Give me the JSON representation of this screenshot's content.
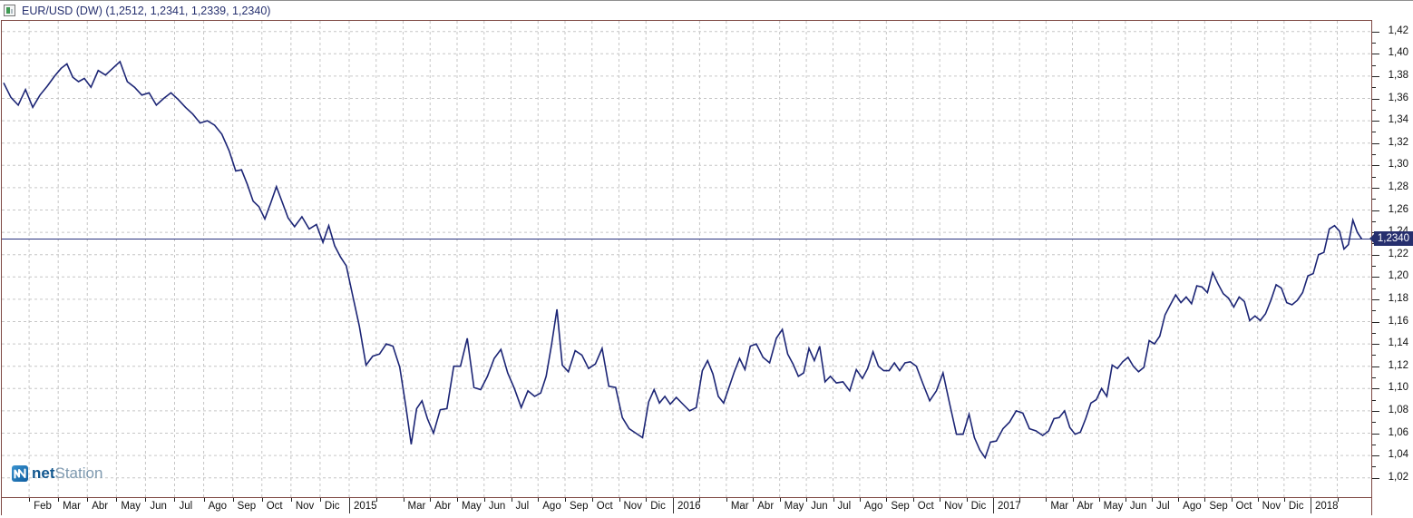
{
  "title_bar": {
    "title": "EUR/USD (DW) (1,2512, 1,2341, 1,2339, 1,2340)"
  },
  "logo": {
    "bold": "net",
    "light": "Station"
  },
  "colors": {
    "frame": "#7d4742",
    "series_line": "#1c2575",
    "grid": "#c6c6c6",
    "last_price_line": "#2a3480",
    "tag_bg": "#262f6e",
    "tag_text": "#ffffff",
    "title_text": "#252f6e",
    "axis_text": "#111111"
  },
  "chart_data": {
    "type": "line",
    "symbol": "EUR/USD",
    "timeframe_label": "(DW)",
    "ohlc_readout": [
      "1,2512",
      "1,2341",
      "1,2339",
      "1,2340"
    ],
    "last_price": 1.234,
    "last_price_label": "1,2340",
    "ylim": [
      1.005,
      1.435
    ],
    "grid": {
      "vertical": "monthly-dashed",
      "horizontal": "0.02-dashed"
    },
    "legend": "none",
    "y_ticks": [
      {
        "v": 1.42,
        "label": "1,42"
      },
      {
        "v": 1.4,
        "label": "1,40"
      },
      {
        "v": 1.38,
        "label": "1,38"
      },
      {
        "v": 1.36,
        "label": "1,36"
      },
      {
        "v": 1.34,
        "label": "1,34"
      },
      {
        "v": 1.32,
        "label": "1,32"
      },
      {
        "v": 1.3,
        "label": "1,30"
      },
      {
        "v": 1.28,
        "label": "1,28"
      },
      {
        "v": 1.26,
        "label": "1,26"
      },
      {
        "v": 1.24,
        "label": "1,24"
      },
      {
        "v": 1.22,
        "label": "1,22"
      },
      {
        "v": 1.2,
        "label": "1,20"
      },
      {
        "v": 1.18,
        "label": "1,18"
      },
      {
        "v": 1.16,
        "label": "1,16"
      },
      {
        "v": 1.14,
        "label": "1,14"
      },
      {
        "v": 1.12,
        "label": "1,12"
      },
      {
        "v": 1.1,
        "label": "1,10"
      },
      {
        "v": 1.08,
        "label": "1,08"
      },
      {
        "v": 1.06,
        "label": "1,06"
      },
      {
        "v": 1.04,
        "label": "1,04"
      },
      {
        "v": 1.02,
        "label": "1,02"
      }
    ],
    "x_labels": [
      {
        "text": "Feb",
        "m": 1
      },
      {
        "text": "Mar",
        "m": 2
      },
      {
        "text": "Abr",
        "m": 3
      },
      {
        "text": "May",
        "m": 4
      },
      {
        "text": "Jun",
        "m": 5
      },
      {
        "text": "Jul",
        "m": 6
      },
      {
        "text": "Ago",
        "m": 7
      },
      {
        "text": "Sep",
        "m": 8
      },
      {
        "text": "Oct",
        "m": 9
      },
      {
        "text": "Nov",
        "m": 10
      },
      {
        "text": "Dic",
        "m": 11
      },
      {
        "text": "2015",
        "m": 12,
        "year": true
      },
      {
        "text": "Mar",
        "m": 14
      },
      {
        "text": "Abr",
        "m": 15
      },
      {
        "text": "May",
        "m": 16
      },
      {
        "text": "Jun",
        "m": 17
      },
      {
        "text": "Jul",
        "m": 18
      },
      {
        "text": "Ago",
        "m": 19
      },
      {
        "text": "Sep",
        "m": 20
      },
      {
        "text": "Oct",
        "m": 21
      },
      {
        "text": "Nov",
        "m": 22
      },
      {
        "text": "Dic",
        "m": 23
      },
      {
        "text": "2016",
        "m": 24,
        "year": true
      },
      {
        "text": "Mar",
        "m": 26
      },
      {
        "text": "Abr",
        "m": 27
      },
      {
        "text": "May",
        "m": 28
      },
      {
        "text": "Jun",
        "m": 29
      },
      {
        "text": "Jul",
        "m": 30
      },
      {
        "text": "Ago",
        "m": 31
      },
      {
        "text": "Sep",
        "m": 32
      },
      {
        "text": "Oct",
        "m": 33
      },
      {
        "text": "Nov",
        "m": 34
      },
      {
        "text": "Dic",
        "m": 35
      },
      {
        "text": "2017",
        "m": 36,
        "year": true
      },
      {
        "text": "Mar",
        "m": 38
      },
      {
        "text": "Abr",
        "m": 39
      },
      {
        "text": "May",
        "m": 40
      },
      {
        "text": "Jun",
        "m": 41
      },
      {
        "text": "Jul",
        "m": 42
      },
      {
        "text": "Ago",
        "m": 43
      },
      {
        "text": "Sep",
        "m": 44
      },
      {
        "text": "Oct",
        "m": 45
      },
      {
        "text": "Nov",
        "m": 46
      },
      {
        "text": "Dic",
        "m": 47
      },
      {
        "text": "2018",
        "m": 48,
        "year": true
      }
    ],
    "series": [
      {
        "month": "2014-01",
        "values": [
          1.374,
          1.361,
          1.354,
          1.368
        ]
      },
      {
        "month": "2014-02",
        "values": [
          1.352,
          1.363,
          1.371,
          1.38
        ]
      },
      {
        "month": "2014-03",
        "values": [
          1.387,
          1.391,
          1.379,
          1.375,
          1.378
        ]
      },
      {
        "month": "2014-04",
        "values": [
          1.37,
          1.385,
          1.381,
          1.387
        ]
      },
      {
        "month": "2014-05",
        "values": [
          1.393,
          1.375,
          1.37,
          1.363
        ]
      },
      {
        "month": "2014-06",
        "values": [
          1.365,
          1.354,
          1.36,
          1.365
        ]
      },
      {
        "month": "2014-07",
        "values": [
          1.359,
          1.352,
          1.346,
          1.338
        ]
      },
      {
        "month": "2014-08",
        "values": [
          1.34,
          1.336,
          1.328,
          1.313
        ]
      },
      {
        "month": "2014-09",
        "values": [
          1.295,
          1.296,
          1.283,
          1.268,
          1.263
        ]
      },
      {
        "month": "2014-10",
        "values": [
          1.252,
          1.266,
          1.281,
          1.267,
          1.253
        ]
      },
      {
        "month": "2014-11",
        "values": [
          1.245,
          1.254,
          1.243,
          1.247
        ]
      },
      {
        "month": "2014-12",
        "values": [
          1.231,
          1.246,
          1.228,
          1.218,
          1.21
        ]
      },
      {
        "month": "2015-01",
        "values": [
          1.184,
          1.156,
          1.121,
          1.129
        ]
      },
      {
        "month": "2015-02",
        "values": [
          1.131,
          1.14,
          1.138,
          1.119
        ]
      },
      {
        "month": "2015-03",
        "values": [
          1.084,
          1.05,
          1.082,
          1.089,
          1.073
        ]
      },
      {
        "month": "2015-04",
        "values": [
          1.06,
          1.081,
          1.082,
          1.12
        ]
      },
      {
        "month": "2015-05",
        "values": [
          1.12,
          1.145,
          1.101,
          1.099
        ]
      },
      {
        "month": "2015-06",
        "values": [
          1.111,
          1.127,
          1.135,
          1.114
        ]
      },
      {
        "month": "2015-07",
        "values": [
          1.1,
          1.083,
          1.098,
          1.093
        ]
      },
      {
        "month": "2015-08",
        "values": [
          1.096,
          1.111,
          1.139,
          1.171,
          1.121
        ]
      },
      {
        "month": "2015-09",
        "values": [
          1.115,
          1.134,
          1.13,
          1.118
        ]
      },
      {
        "month": "2015-10",
        "values": [
          1.122,
          1.136,
          1.102,
          1.101
        ]
      },
      {
        "month": "2015-11",
        "values": [
          1.074,
          1.064,
          1.06,
          1.056
        ]
      },
      {
        "month": "2015-12",
        "values": [
          1.088,
          1.099,
          1.087,
          1.093,
          1.086
        ]
      },
      {
        "month": "2016-01",
        "values": [
          1.092,
          1.086,
          1.08,
          1.083
        ]
      },
      {
        "month": "2016-02",
        "values": [
          1.116,
          1.125,
          1.113,
          1.093,
          1.087
        ]
      },
      {
        "month": "2016-03",
        "values": [
          1.101,
          1.115,
          1.127,
          1.117,
          1.138
        ]
      },
      {
        "month": "2016-04",
        "values": [
          1.14,
          1.128,
          1.123,
          1.145
        ]
      },
      {
        "month": "2016-05",
        "values": [
          1.153,
          1.131,
          1.122,
          1.111,
          1.114
        ]
      },
      {
        "month": "2016-06",
        "values": [
          1.136,
          1.125,
          1.138,
          1.106,
          1.111
        ]
      },
      {
        "month": "2016-07",
        "values": [
          1.105,
          1.106,
          1.098,
          1.117
        ]
      },
      {
        "month": "2016-08",
        "values": [
          1.109,
          1.118,
          1.133,
          1.12,
          1.116
        ]
      },
      {
        "month": "2016-09",
        "values": [
          1.116,
          1.123,
          1.116,
          1.123,
          1.124
        ]
      },
      {
        "month": "2016-10",
        "values": [
          1.12,
          1.104,
          1.089,
          1.098
        ]
      },
      {
        "month": "2016-11",
        "values": [
          1.114,
          1.086,
          1.059,
          1.059
        ]
      },
      {
        "month": "2016-12",
        "values": [
          1.077,
          1.056,
          1.045,
          1.038,
          1.052
        ]
      },
      {
        "month": "2017-01",
        "values": [
          1.053,
          1.064,
          1.07,
          1.08
        ]
      },
      {
        "month": "2017-02",
        "values": [
          1.078,
          1.064,
          1.062,
          1.058
        ]
      },
      {
        "month": "2017-03",
        "values": [
          1.062,
          1.073,
          1.074,
          1.08,
          1.065
        ]
      },
      {
        "month": "2017-04",
        "values": [
          1.059,
          1.061,
          1.073,
          1.087,
          1.09
        ]
      },
      {
        "month": "2017-05",
        "values": [
          1.1,
          1.093,
          1.121,
          1.118,
          1.124
        ]
      },
      {
        "month": "2017-06",
        "values": [
          1.128,
          1.12,
          1.115,
          1.119,
          1.143
        ]
      },
      {
        "month": "2017-07",
        "values": [
          1.14,
          1.147,
          1.166,
          1.175,
          1.184
        ]
      },
      {
        "month": "2017-08",
        "values": [
          1.177,
          1.182,
          1.176,
          1.192,
          1.191
        ]
      },
      {
        "month": "2017-09",
        "values": [
          1.186,
          1.204,
          1.194,
          1.185,
          1.181
        ]
      },
      {
        "month": "2017-10",
        "values": [
          1.173,
          1.182,
          1.178,
          1.161,
          1.165
        ]
      },
      {
        "month": "2017-11",
        "values": [
          1.161,
          1.167,
          1.179,
          1.193,
          1.19
        ]
      },
      {
        "month": "2017-12",
        "values": [
          1.177,
          1.175,
          1.179,
          1.186,
          1.201
        ]
      },
      {
        "month": "2018-01",
        "values": [
          1.203,
          1.22,
          1.222,
          1.243,
          1.246
        ]
      },
      {
        "month": "2018-02",
        "values": [
          1.241,
          1.225,
          1.229,
          1.251,
          1.24,
          1.234
        ]
      }
    ]
  }
}
